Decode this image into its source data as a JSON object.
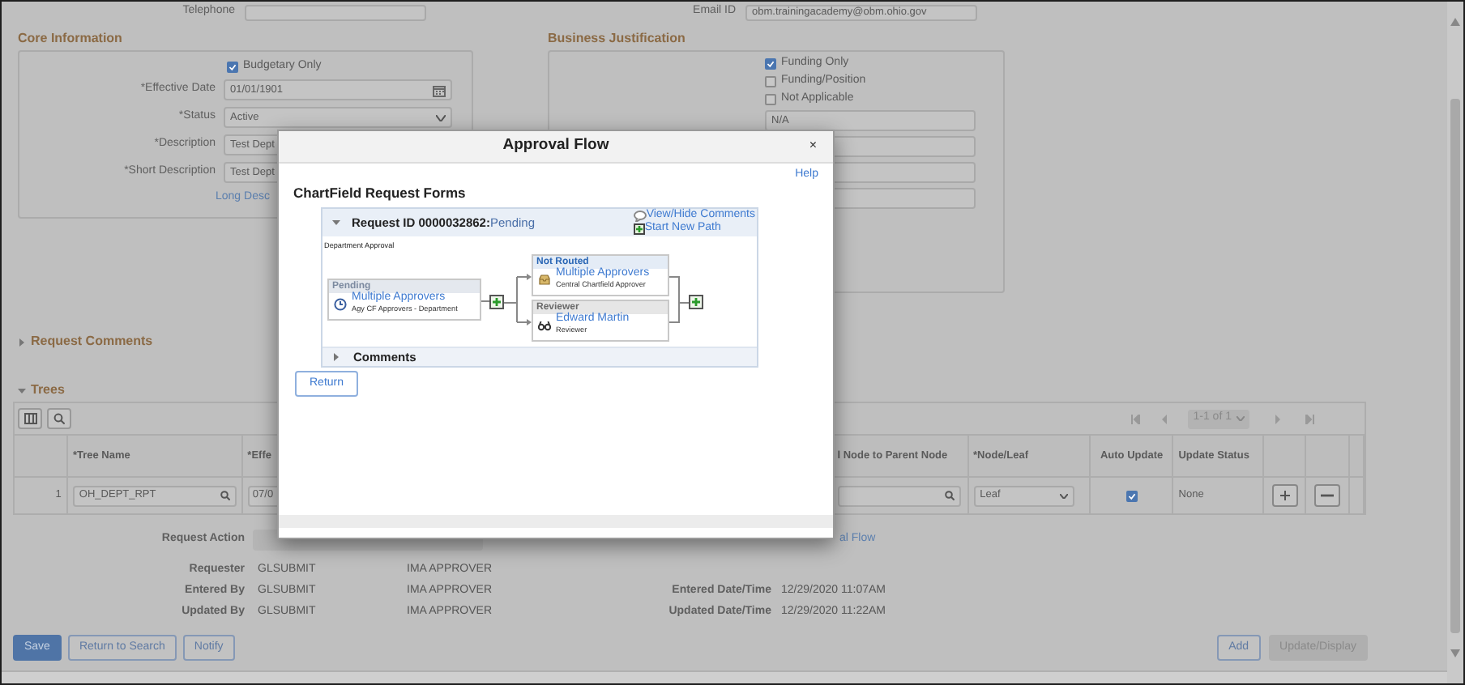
{
  "top_fields": [
    {
      "label": "Telephone"
    },
    {
      "label": "Email ID",
      "value": "obm.trainingacademy@obm.ohio.gov"
    }
  ],
  "core_information": {
    "title": "Core Information",
    "budgetary_only": {
      "label": "Budgetary Only",
      "checked": true
    },
    "fields": [
      {
        "label": "*Effective Date",
        "value": "01/01/1901",
        "kind": "date"
      },
      {
        "label": "*Status",
        "value": "Active",
        "kind": "select"
      },
      {
        "label": "*Description",
        "value": "Test Dept",
        "kind": "text"
      },
      {
        "label": "*Short Description",
        "value": "Test Dept",
        "kind": "text"
      }
    ],
    "link": "Long Desc"
  },
  "business_justification": {
    "title": "Business Justification",
    "options": [
      {
        "label": "Funding Only",
        "checked": true
      },
      {
        "label": "Funding/Position",
        "checked": false
      },
      {
        "label": "Not Applicable",
        "checked": false
      }
    ],
    "fields": [
      {
        "kind": "text",
        "value": "N/A"
      },
      {
        "kind": "text"
      },
      {
        "kind": "text"
      },
      {
        "kind": "text"
      }
    ]
  },
  "request_comments": {
    "title": "Request Comments",
    "expanded": false
  },
  "trees": {
    "title": "Trees",
    "expanded": true,
    "pagination": "1-1 of 1",
    "columns": [
      "*Tree Name",
      "*Effe",
      "l Node to Parent Node",
      "*Node/Leaf",
      "Auto Update",
      "Update Status"
    ],
    "rows": [
      {
        "number": "1",
        "tree_name": "OH_DEPT_RPT",
        "column_2": "07/0",
        "node_leaf": "Leaf",
        "auto_update": true,
        "update_status": "None"
      }
    ]
  },
  "request_action": {
    "label": "Request Action",
    "link": "al Flow"
  },
  "audit": [
    {
      "label": "Requester",
      "user_id": "GLSUBMIT",
      "name": "IMA APPROVER"
    },
    {
      "label": "Entered By",
      "user_id": "GLSUBMIT",
      "name": "IMA APPROVER",
      "date_label": "Entered Date/Time",
      "date": "12/29/2020 11:07AM"
    },
    {
      "label": "Updated By",
      "user_id": "GLSUBMIT",
      "name": "IMA APPROVER",
      "date_label": "Updated Date/Time",
      "date": "12/29/2020 11:22AM"
    }
  ],
  "buttons_left": [
    {
      "label": "Save",
      "kind": "primary"
    },
    {
      "label": "Return to Search",
      "kind": "outline"
    },
    {
      "label": "Notify",
      "kind": "outline"
    }
  ],
  "buttons_right": [
    {
      "label": "Add",
      "kind": "outline"
    },
    {
      "label": "Update/Display",
      "kind": "disabled"
    }
  ],
  "modal": {
    "title": "Approval Flow",
    "close": "×",
    "help": "Help",
    "heading": "ChartField Request Forms",
    "request": {
      "label": "Request ID 0000032862:",
      "status": "Pending",
      "expanded": true,
      "comments_link": "View/Hide Comments",
      "new_path_link": "Start New Path"
    },
    "stage": "Department Approval",
    "steps": [
      {
        "status": "Pending",
        "name": "Multiple Approvers",
        "role": "Agy CF Approvers - Department"
      },
      {
        "status": "Not Routed",
        "name": "Multiple Approvers",
        "role": "Central Chartfield Approver"
      },
      {
        "status": "Reviewer",
        "name": "Edward Martin",
        "role": "Reviewer"
      }
    ],
    "comments": {
      "label": "Comments",
      "expanded": false
    },
    "return_button": "Return"
  }
}
